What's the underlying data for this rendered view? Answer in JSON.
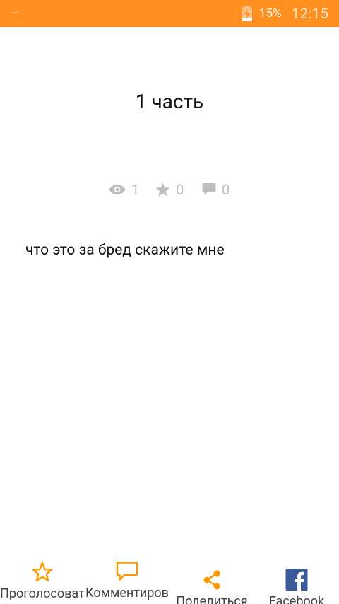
{
  "status_bar": {
    "battery_percent": "15%",
    "time": "12:15",
    "icons": [
      "notification-icon",
      "battery-charging-icon"
    ],
    "background_color": "#ff8f1f"
  },
  "post": {
    "title": "1 часть",
    "stats": {
      "views": "1",
      "votes": "0",
      "comments": "0"
    },
    "body": "что это за бред скажите мне"
  },
  "bottom_bar": {
    "items": [
      {
        "label": "Проголосоват",
        "icon": "star-outline-icon"
      },
      {
        "label": "Комментиров",
        "icon": "comment-outline-icon"
      },
      {
        "label": "Поделиться",
        "icon": "share-icon"
      },
      {
        "label": "Facebook",
        "icon": "facebook-icon"
      }
    ],
    "accent_color": "#ff9800",
    "facebook_color": "#3b5998"
  }
}
